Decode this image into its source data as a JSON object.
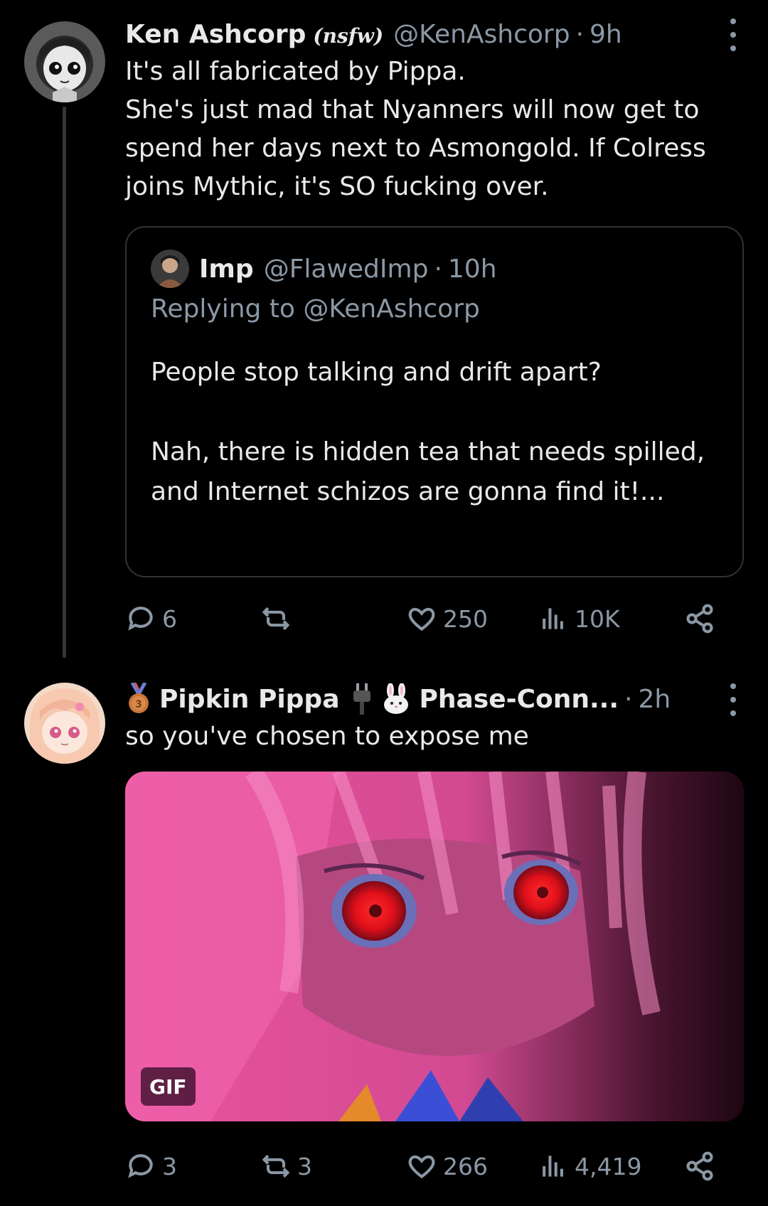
{
  "tweets": [
    {
      "display_name": "Ken Ashcorp",
      "name_suffix": "(nsfw)",
      "handle": "@KenAshcorp",
      "time": "9h",
      "text": "It's all fabricated by Pippa.\nShe's just mad that Nyanners will now get to spend her days next to Asmongold. If Colress joins Mythic, it's SO fucking over.",
      "quote": {
        "display_name": "Imp",
        "handle": "@FlawedImp",
        "time": "10h",
        "replying_to": "Replying to @KenAshcorp",
        "text": "People stop talking and drift apart?\n\nNah, there is hidden tea that needs spilled, and Internet schizos are gonna find it!..."
      },
      "actions": {
        "replies": "6",
        "reposts": "",
        "likes": "250",
        "views": "10K"
      }
    },
    {
      "display_name": "Pipkin Pippa",
      "display_name_tail": "Phase-Conn...",
      "time": "2h",
      "text": "so you've chosen to expose me",
      "media_badge": "GIF",
      "actions": {
        "replies": "3",
        "reposts": "3",
        "likes": "266",
        "views": "4,419"
      }
    }
  ],
  "icons": {
    "reply": "reply-icon",
    "repost": "repost-icon",
    "like": "heart-icon",
    "views": "views-icon",
    "share": "share-icon",
    "more": "more-icon",
    "medal": "bronze-medal-icon",
    "plug": "plug-icon",
    "rabbit": "rabbit-icon"
  },
  "colors": {
    "background": "#000000",
    "text": "#e7e9ea",
    "muted": "#8b98a5",
    "border": "#2f3336"
  }
}
